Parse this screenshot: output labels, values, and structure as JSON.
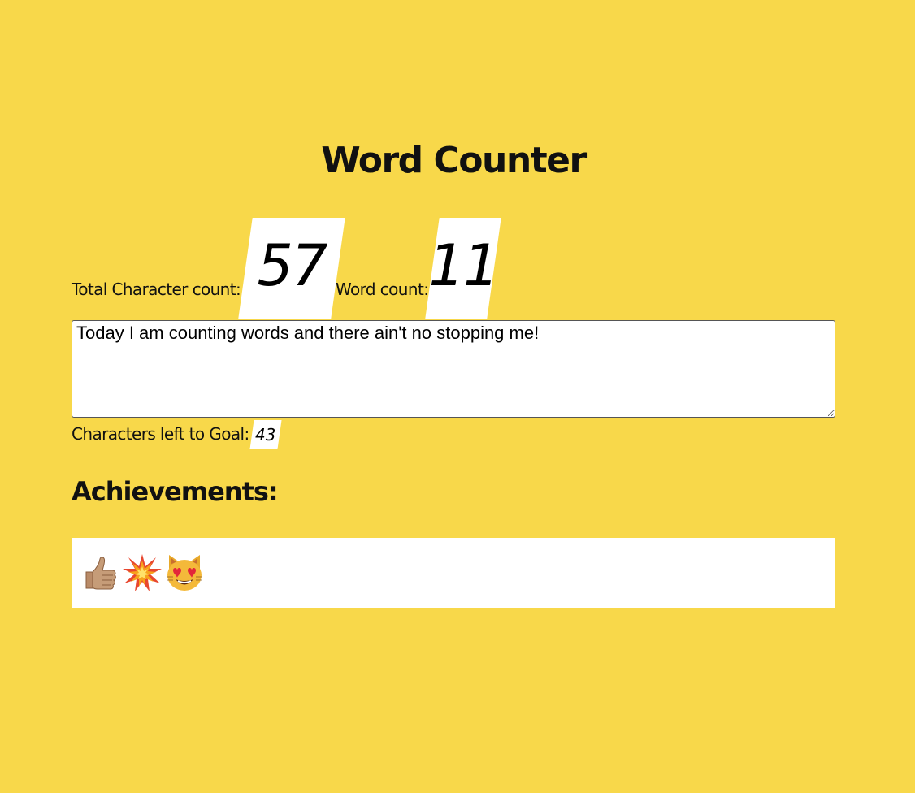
{
  "title": "Word Counter",
  "counts": {
    "char_label": "Total Character count:",
    "char_value": "57",
    "word_label": "Word count:",
    "word_value": "11"
  },
  "input": {
    "value": "Today I am counting words and there ain't no stopping me!"
  },
  "goal": {
    "label": "Characters left to Goal:",
    "value": "43"
  },
  "achievements": {
    "heading": "Achievements:",
    "badges": [
      "thumbs-up-icon",
      "collision-icon",
      "heart-eyes-cat-icon"
    ]
  },
  "colors": {
    "background": "#F8D84A",
    "box": "#FFFFFF"
  }
}
